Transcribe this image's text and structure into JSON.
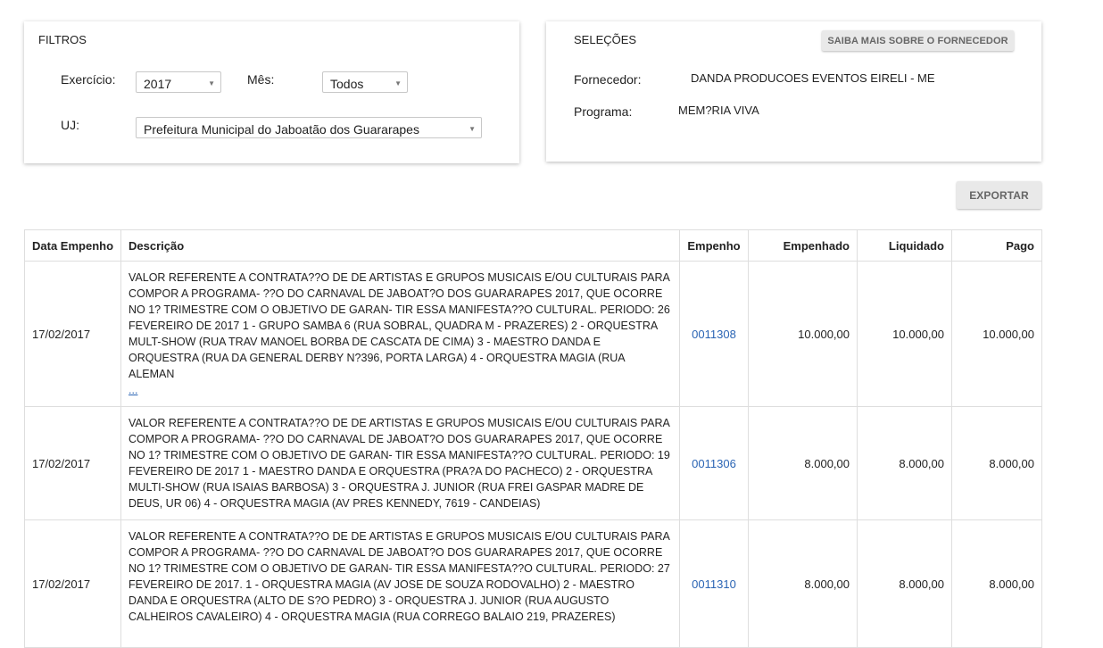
{
  "filtros": {
    "title": "FILTROS",
    "exercicio_label": "Exercício:",
    "exercicio_value": "2017",
    "mes_label": "Mês:",
    "mes_value": "Todos",
    "uj_label": "UJ:",
    "uj_value": "Prefeitura Municipal do Jaboatão dos Guararapes"
  },
  "selecoes": {
    "title": "SELEÇÕES",
    "button_label": "SAIBA MAIS SOBRE O FORNECEDOR",
    "fornecedor_label": "Fornecedor:",
    "fornecedor_value": "DANDA PRODUCOES EVENTOS EIRELI - ME",
    "programa_label": "Programa:",
    "programa_value": "MEM?RIA VIVA"
  },
  "toolbar": {
    "exportar_label": "EXPORTAR"
  },
  "table": {
    "headers": [
      "Data Empenho",
      "Descrição",
      "Empenho",
      "Empenhado",
      "Liquidado",
      "Pago"
    ],
    "rows": [
      {
        "data": "17/02/2017",
        "descricao": "VALOR REFERENTE A CONTRATA??O DE DE ARTISTAS E GRUPOS MUSICAIS E/OU CULTURAIS PARA COMPOR A PROGRAMA- ??O DO CARNAVAL DE JABOAT?O DOS GUARARAPES 2017, QUE OCORRE NO 1? TRIMESTRE COM O OBJETIVO DE GARAN- TIR ESSA MANIFESTA??O CULTURAL. PERIODO: 26 FEVEREIRO DE 2017 1 - GRUPO SAMBA 6 (RUA SOBRAL, QUADRA M - PRAZERES) 2 - ORQUESTRA MULT-SHOW (RUA TRAV MANOEL BORBA DE CASCATA DE CIMA) 3 - MAESTRO DANDA E ORQUESTRA (RUA DA GENERAL DERBY N?396, PORTA LARGA) 4 - ORQUESTRA MAGIA (RUA ALEMAN",
        "more": "...",
        "empenho": "0011308",
        "empenhado": "10.000,00",
        "liquidado": "10.000,00",
        "pago": "10.000,00"
      },
      {
        "data": "17/02/2017",
        "descricao": "VALOR REFERENTE A CONTRATA??O DE DE ARTISTAS E GRUPOS MUSICAIS E/OU CULTURAIS PARA COMPOR A PROGRAMA- ??O DO CARNAVAL DE JABOAT?O DOS GUARARAPES 2017, QUE OCORRE NO 1? TRIMESTRE COM O OBJETIVO DE GARAN- TIR ESSA MANIFESTA??O CULTURAL. PERIODO: 19 FEVEREIRO DE 2017 1 - MAESTRO DANDA E ORQUESTRA (PRA?A DO PACHECO) 2 - ORQUESTRA MULTI-SHOW (RUA ISAIAS BARBOSA) 3 - ORQUESTRA J. JUNIOR (RUA FREI GASPAR MADRE DE DEUS, UR 06) 4 - ORQUESTRA MAGIA (AV PRES KENNEDY, 7619 - CANDEIAS)",
        "more": "",
        "empenho": "0011306",
        "empenhado": "8.000,00",
        "liquidado": "8.000,00",
        "pago": "8.000,00"
      },
      {
        "data": "17/02/2017",
        "descricao": "VALOR REFERENTE A CONTRATA??O DE DE ARTISTAS E GRUPOS MUSICAIS E/OU CULTURAIS PARA COMPOR A PROGRAMA- ??O DO CARNAVAL DE JABOAT?O DOS GUARARAPES 2017, QUE OCORRE NO 1? TRIMESTRE COM O OBJETIVO DE GARAN- TIR ESSA MANIFESTA??O CULTURAL. PERIODO: 27 FEVEREIRO DE 2017. 1 - ORQUESTRA MAGIA (AV JOSE DE SOUZA RODOVALHO) 2 - MAESTRO DANDA E ORQUESTRA (ALTO DE S?O PEDRO) 3 - ORQUESTRA J. JUNIOR (RUA AUGUSTO CALHEIROS CAVALEIRO) 4 - ORQUESTRA MAGIA (RUA CORREGO BALAIO 219, PRAZERES)",
        "more": "",
        "empenho": "0011310",
        "empenhado": "8.000,00",
        "liquidado": "8.000,00",
        "pago": "8.000,00"
      }
    ]
  }
}
